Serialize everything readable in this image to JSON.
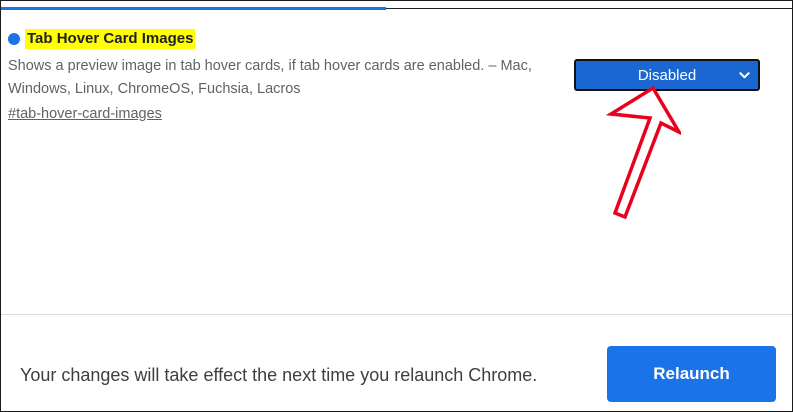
{
  "flag": {
    "title": "Tab Hover Card Images",
    "description": "Shows a preview image in tab hover cards, if tab hover cards are enabled. – Mac, Windows, Linux, ChromeOS, Fuchsia, Lacros",
    "link": "#tab-hover-card-images",
    "select_value": "Disabled"
  },
  "footer": {
    "message": "Your changes will take effect the next time you relaunch Chrome.",
    "relaunch_label": "Relaunch"
  },
  "colors": {
    "accent": "#1a73e8",
    "highlight": "#ffff00",
    "annotation_arrow": "#e8001c"
  },
  "icons": {
    "status": "blue-dot-icon",
    "dropdown": "chevron-down-icon",
    "annotation": "red-arrow-icon"
  }
}
